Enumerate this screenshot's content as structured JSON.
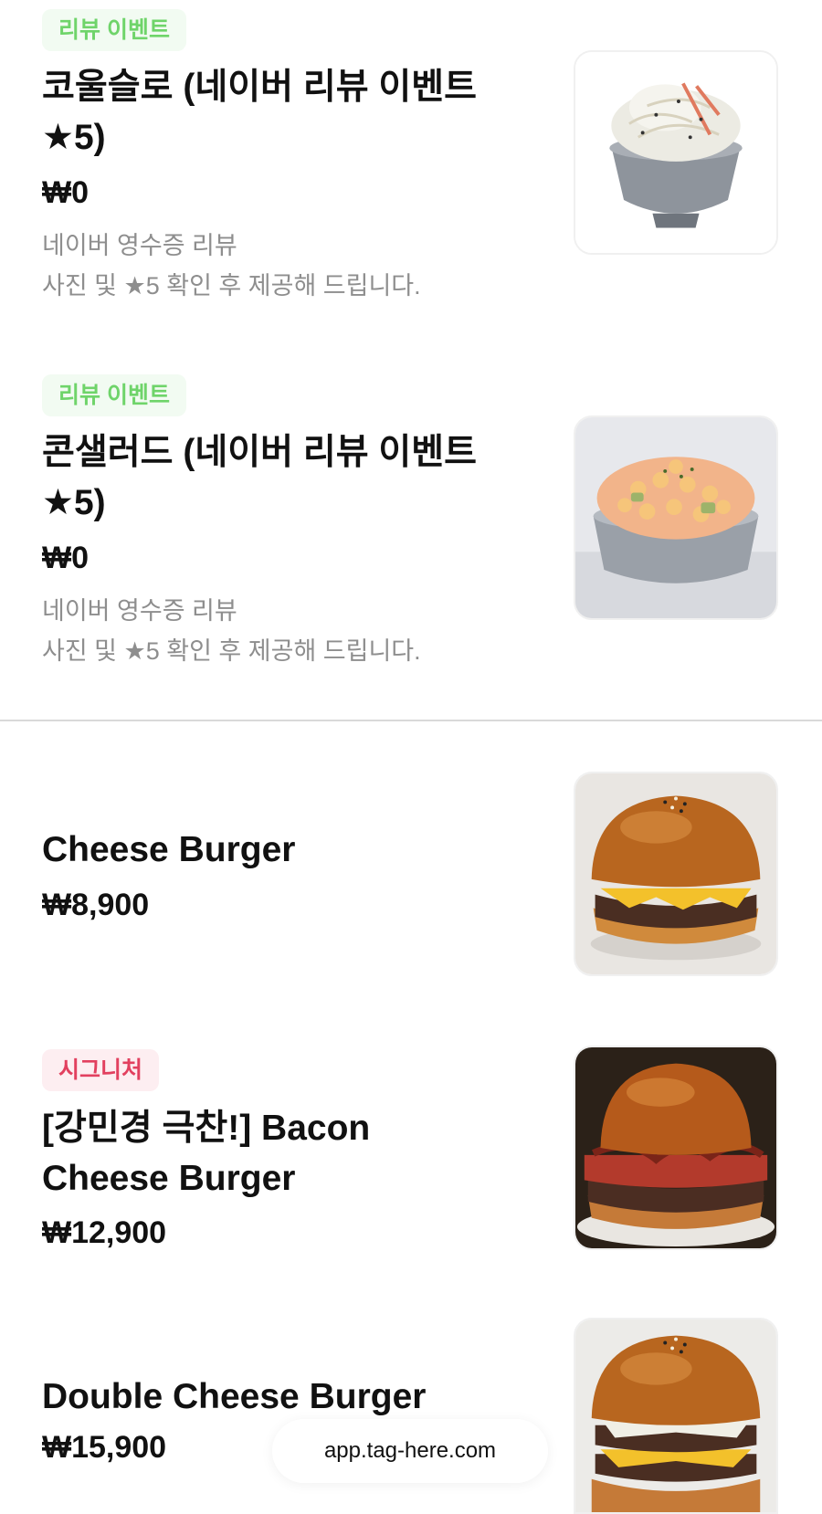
{
  "menu": {
    "items": [
      {
        "badge": "리뷰 이벤트",
        "title_line1": "코울슬로 (네이버 리뷰 이벤트",
        "title_line2": "★5)",
        "price": "₩0",
        "desc_line1": "네이버 영수증 리뷰",
        "desc_line2": "사진 및 ★5 확인 후 제공해 드립니다.",
        "image": "coleslaw-bowl"
      },
      {
        "badge": "리뷰 이벤트",
        "title_line1": "콘샐러드 (네이버 리뷰 이벤트",
        "title_line2": "★5)",
        "price": "₩0",
        "desc_line1": "네이버 영수증 리뷰",
        "desc_line2": "사진 및 ★5 확인 후 제공해 드립니다.",
        "image": "corn-salad-bowl"
      },
      {
        "title": "Cheese Burger",
        "price": "₩8,900",
        "image": "cheese-burger"
      },
      {
        "badge": "시그니처",
        "title_line1": "[강민경 극찬!] Bacon",
        "title_line2": "Cheese Burger",
        "price": "₩12,900",
        "image": "bacon-cheese-burger"
      },
      {
        "title": "Double Cheese Burger",
        "price": "₩15,900",
        "image": "double-cheese-burger"
      }
    ]
  },
  "footer": {
    "url": "app.tag-here.com"
  },
  "colors": {
    "review_badge_text": "#6fd46a",
    "review_badge_bg": "#f2fbf2",
    "signature_badge_text": "#e2405f",
    "signature_badge_bg": "#fdeef1"
  }
}
